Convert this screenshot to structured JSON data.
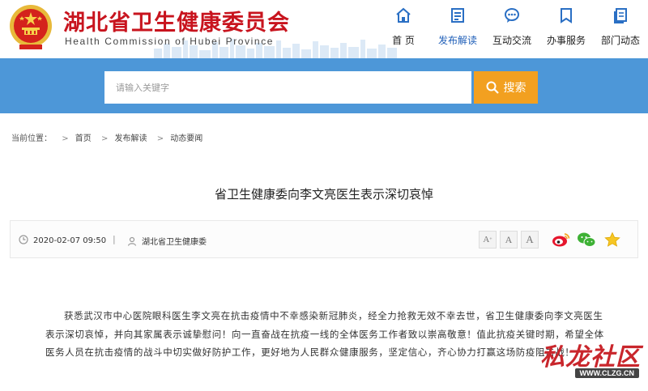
{
  "header": {
    "site_title": "湖北省卫生健康委员会",
    "site_subtitle": "Health Commission of Hubei Province",
    "brand_color": "#c8141e",
    "nav": [
      {
        "label": "首 页",
        "icon": "home-icon"
      },
      {
        "label": "发布解读",
        "icon": "document-icon",
        "active": true
      },
      {
        "label": "互动交流",
        "icon": "chat-bubble-icon"
      },
      {
        "label": "办事服务",
        "icon": "bookmark-icon"
      },
      {
        "label": "部门动态",
        "icon": "pages-icon"
      }
    ]
  },
  "search": {
    "placeholder": "请输入关键字",
    "button_label": "搜索",
    "band_color": "#4d97d8",
    "button_color": "#f2a020"
  },
  "breadcrumb": {
    "prefix": "当前位置：",
    "items": [
      "首页",
      "发布解读",
      "动态要闻"
    ]
  },
  "article": {
    "title": "省卫生健康委向李文亮医生表示深切哀悼",
    "date": "2020-02-07 09:50",
    "source": "湖北省卫生健康委",
    "font_sizes": [
      "A",
      "A",
      "A"
    ],
    "share": [
      "weibo-icon",
      "wechat-icon",
      "favorite-star-icon"
    ],
    "body": "获悉武汉市中心医院眼科医生李文亮在抗击疫情中不幸感染新冠肺炎，经全力抢救无效不幸去世，省卫生健康委向李文亮医生表示深切哀悼，并向其家属表示诚挚慰问！向一直奋战在抗疫一线的全体医务工作者致以崇高敬意！值此抗疫关键时期，希望全体医务人员在抗击疫情的战斗中切实做好防护工作，更好地为人民群众健康服务，坚定信心，齐心协力打赢这场防疫阻击战！"
  },
  "watermark": {
    "main": "私龙社区",
    "url": "WWW.CLZG.CN"
  }
}
